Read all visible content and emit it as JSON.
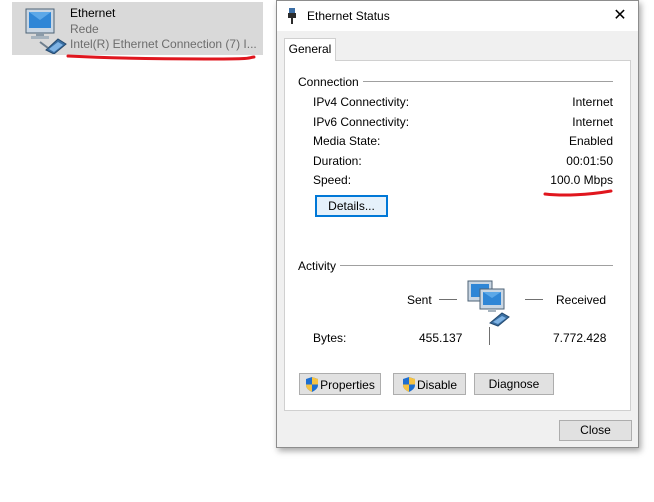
{
  "adapter": {
    "name": "Ethernet",
    "network": "Rede",
    "device": "Intel(R) Ethernet Connection (7) I..."
  },
  "dialog": {
    "title": "Ethernet Status",
    "close_glyph": "✕",
    "tab_general": "General",
    "connection": {
      "label": "Connection",
      "rows": [
        {
          "label": "IPv4 Connectivity:",
          "value": "Internet"
        },
        {
          "label": "IPv6 Connectivity:",
          "value": "Internet"
        },
        {
          "label": "Media State:",
          "value": "Enabled"
        },
        {
          "label": "Duration:",
          "value": "00:01:50"
        },
        {
          "label": "Speed:",
          "value": "100.0 Mbps"
        }
      ],
      "details_button": "Details..."
    },
    "activity": {
      "label": "Activity",
      "sent": "Sent",
      "received": "Received",
      "bytes_label": "Bytes:",
      "bytes_sent": "455.137",
      "bytes_received": "7.772.428"
    },
    "buttons": {
      "properties": "Properties",
      "disable": "Disable",
      "diagnose": "Diagnose",
      "close": "Close"
    }
  },
  "icons": {
    "adapter": "network-adapter-icon",
    "title": "ethernet-plug-icon",
    "activity": "network-activity-icon",
    "shield": "uac-shield-icon"
  },
  "colors": {
    "annotation": "#e0161e",
    "accent": "#0078d7",
    "tile_background": "#d9d9d9"
  }
}
